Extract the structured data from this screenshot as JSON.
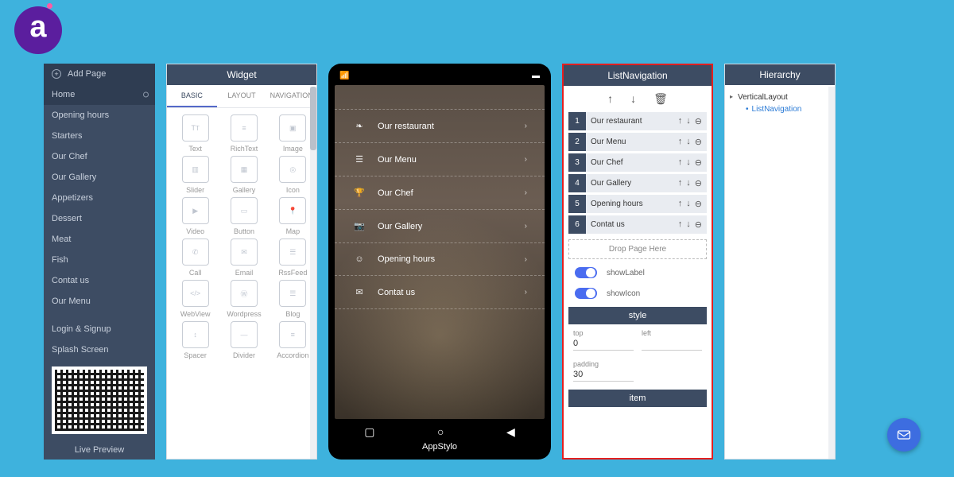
{
  "sidebar": {
    "add_page": "Add Page",
    "pages": [
      "Home",
      "Opening hours",
      "Starters",
      "Our Chef",
      "Our Gallery",
      "Appetizers",
      "Dessert",
      "Meat",
      "Fish",
      "Contat us",
      "Our Menu"
    ],
    "active_index": 0,
    "extra": [
      "Login & Signup",
      "Splash Screen"
    ],
    "live_preview": "Live Preview"
  },
  "widget": {
    "title": "Widget",
    "tabs": [
      "BASIC",
      "LAYOUT",
      "NAVIGATION"
    ],
    "active_tab": 0,
    "items": [
      "Text",
      "RichText",
      "Image",
      "Slider",
      "Gallery",
      "Icon",
      "Video",
      "Button",
      "Map",
      "Call",
      "Email",
      "RssFeed",
      "WebView",
      "Wordpress",
      "Blog",
      "Spacer",
      "Divider",
      "Accordion"
    ]
  },
  "phone": {
    "brand": "AppStylo",
    "menu": [
      {
        "icon": "leaf",
        "label": "Our restaurant"
      },
      {
        "icon": "bars",
        "label": "Our Menu"
      },
      {
        "icon": "trophy",
        "label": "Our Chef"
      },
      {
        "icon": "camera",
        "label": "Our Gallery"
      },
      {
        "icon": "smile",
        "label": "Opening hours"
      },
      {
        "icon": "mail",
        "label": "Contat us"
      }
    ]
  },
  "inspector": {
    "title": "ListNavigation",
    "items": [
      "Our restaurant",
      "Our Menu",
      "Our Chef",
      "Our Gallery",
      "Opening hours",
      "Contat us"
    ],
    "drop_hint": "Drop Page Here",
    "toggles": [
      {
        "label": "showLabel",
        "on": true
      },
      {
        "label": "showIcon",
        "on": true
      }
    ],
    "style_title": "style",
    "style_fields": {
      "top": "0",
      "left": "",
      "padding": "30"
    },
    "item_title": "item"
  },
  "hierarchy": {
    "title": "Hierarchy",
    "root": "VerticalLayout",
    "child": "ListNavigation"
  }
}
